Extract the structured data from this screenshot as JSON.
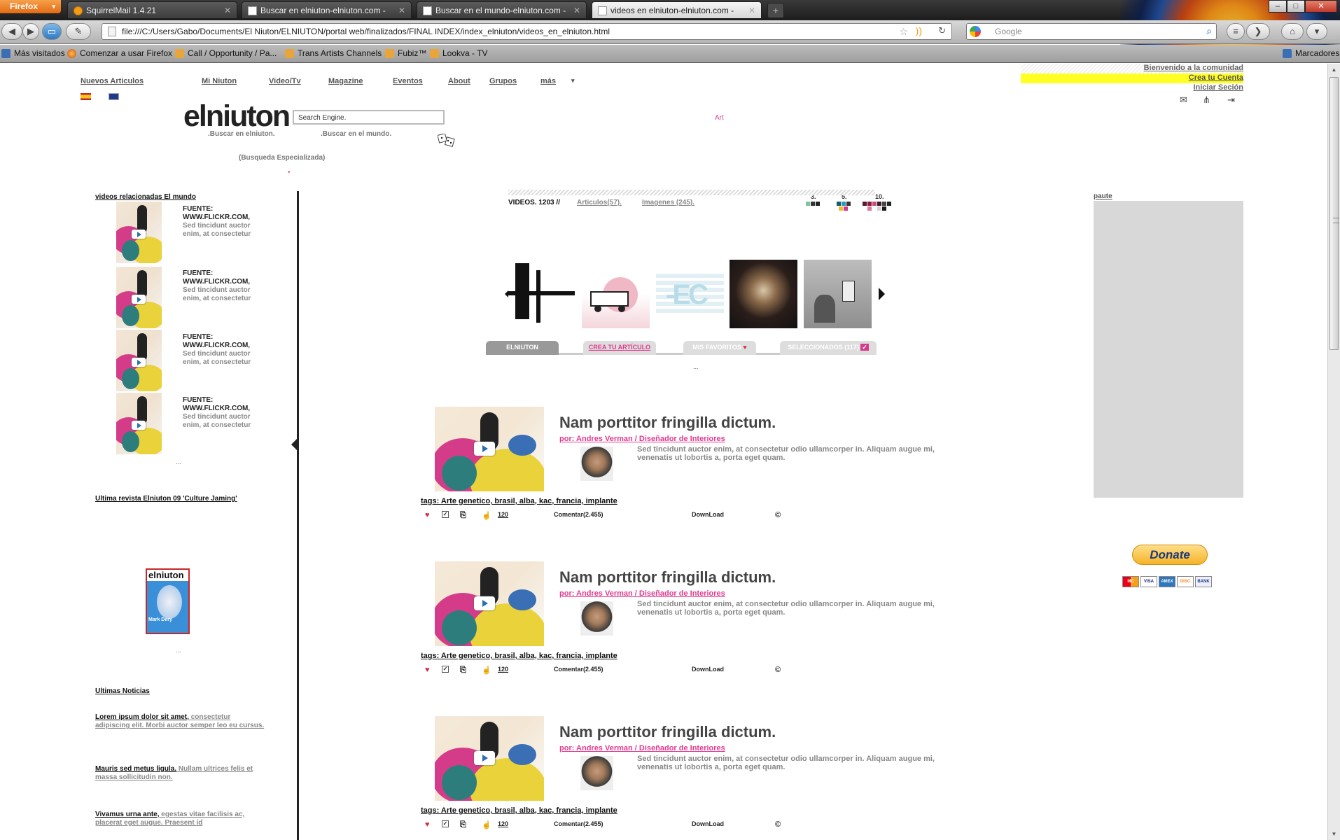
{
  "browser": {
    "menu_label": "Firefox",
    "tabs": [
      {
        "label": "SquirrelMail 1.4.21",
        "active": false
      },
      {
        "label": "Buscar en elniuton-elniuton.com -",
        "active": false
      },
      {
        "label": "Buscar en el mundo-elniuton.com -",
        "active": false
      },
      {
        "label": "videos en elniuton-elniuton.com -",
        "active": true
      }
    ],
    "url": "file:///C:/Users/Gabo/Documents/El Niuton/ELNIUTON/portal web/finalizados/FINAL INDEX/index_elniuton/videos_en_elniuton.html",
    "search_placeholder": "Google",
    "bookmarks": [
      "Más visitados",
      "Comenzar a usar Firefox",
      "Call / Opportunity / Pa...",
      "Trans Artists Channels",
      "Fubiz™",
      "Lookva - TV"
    ],
    "bookmarks_menu": "Marcadores"
  },
  "site": {
    "nav": [
      "Nuevos  Articulos",
      "Mi  Niuton",
      "Video/Tv",
      "Magazine",
      "Eventos",
      "About",
      "Grupos",
      "más"
    ],
    "nav_more_arrow": "▾",
    "brand": "elniuton",
    "search": {
      "prefix": "Art",
      "label": "Search Engine."
    },
    "sub_left": ".Buscar en elniuton.",
    "sub_right": ".Buscar en el mundo.",
    "advanced": "(Busqueda Especializada)",
    "advanced_arrow": "▾",
    "user_links": [
      "Bienvenido a la comunidad",
      "Crea tu Cuenta",
      "Iniciar Seción"
    ],
    "swatch_labels": [
      "3.",
      "5.",
      "10."
    ],
    "left": {
      "related_title": "videos relacionadas El mundo",
      "items": [
        {
          "source": "FUENTE: WWW.FLICKR.COM,",
          "text": "Sed tincidunt auctor enim, at consectetur"
        },
        {
          "source": "FUENTE: WWW.FLICKR.COM,",
          "text": "Sed tincidunt auctor enim, at consectetur"
        },
        {
          "source": "FUENTE: WWW.FLICKR.COM,",
          "text": "Sed tincidunt auctor enim, at consectetur"
        },
        {
          "source": "FUENTE: WWW.FLICKR.COM,",
          "text": "Sed tincidunt auctor enim, at consectetur"
        }
      ],
      "more": "...",
      "magazine_title": "Ultima revista Elniuton 09 'Culture Jaming'",
      "magazine_cover_title": "elniuton",
      "magazine_cover_text": "Mark Dery",
      "news_title": "Ultimas Noticias",
      "news": [
        {
          "head": "Lorem ipsum dolor sit amet,",
          "body": " consectetur adipiscing elit. Morbi auctor semper leo eu cursus."
        },
        {
          "head": "Mauris sed metus ligula.",
          "body": " Nullam ultrices felis et massa sollicitudin non."
        },
        {
          "head": "Vivamus urna ante,",
          "body": " egestas vitae facilisis ac, placerat eget augue. Praesent id"
        }
      ]
    },
    "center": {
      "videos_label": "VIDEOS. 1203 //",
      "articles_link": "Articulos(57).",
      "images_link": "Imagenes (245).",
      "tabs": [
        "ELNIUTON",
        "CREA TU ARTÍCULO",
        "MIS FAVORITOS",
        "SELECCIONADOS (117)"
      ],
      "tab_more": "...",
      "articles": [
        {
          "title": "Nam porttitor fringilla dictum.",
          "by": "por: Andres Verman / Diseñador de Interiores",
          "desc": "Sed tincidunt auctor enim, at consectetur odio ullamcorper in. Aliquam augue mi, venenatis ut lobortis a, porta eget quam.",
          "tags": "tags: Arte genetico, brasil, alba, kac, francia, implante",
          "count": "120",
          "comment": "Comentar(2.455)",
          "download": "DownLoad",
          "copy": "©"
        },
        {
          "title": "Nam porttitor fringilla dictum.",
          "by": "por: Andres Verman / Diseñador de Interiores",
          "desc": "Sed tincidunt auctor enim, at consectetur odio ullamcorper in. Aliquam augue mi, venenatis ut lobortis a, porta eget quam.",
          "tags": "tags: Arte genetico, brasil, alba, kac, francia, implante",
          "count": "120",
          "comment": "Comentar(2.455)",
          "download": "DownLoad",
          "copy": "©"
        },
        {
          "title": "Nam porttitor fringilla dictum.",
          "by": "por: Andres Verman / Diseñador de Interiores",
          "desc": "Sed tincidunt auctor enim, at consectetur odio ullamcorper in. Aliquam augue mi, venenatis ut lobortis a, porta eget quam.",
          "tags": "tags: Arte genetico, brasil, alba, kac, francia, implante",
          "count": "120",
          "comment": "Comentar(2.455)",
          "download": "DownLoad",
          "copy": "©"
        }
      ]
    },
    "right": {
      "ad_label": "paute",
      "donate": "Donate",
      "cards": [
        "MC",
        "VISA",
        "AMEX",
        "DISC",
        "BANK"
      ]
    }
  }
}
